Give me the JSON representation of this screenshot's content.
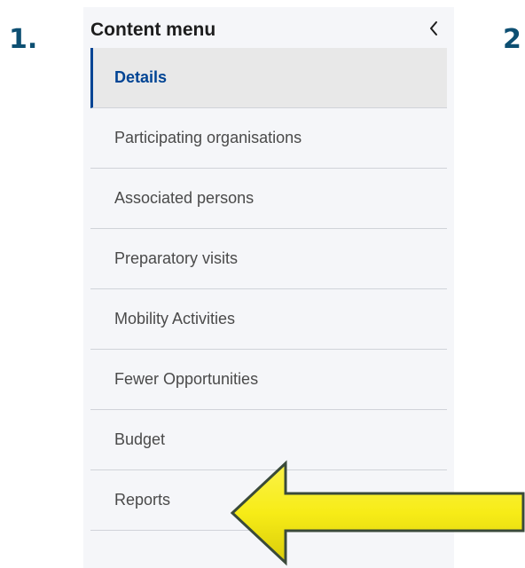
{
  "steps": {
    "first": "1.",
    "second": "2"
  },
  "panel": {
    "title": "Content menu",
    "collapse_icon": "chevron-left-icon",
    "items": [
      {
        "label": "Details",
        "active": true
      },
      {
        "label": "Participating organisations",
        "active": false
      },
      {
        "label": "Associated persons",
        "active": false
      },
      {
        "label": "Preparatory visits",
        "active": false
      },
      {
        "label": "Mobility Activities",
        "active": false
      },
      {
        "label": "Fewer Opportunities",
        "active": false
      },
      {
        "label": "Budget",
        "active": false
      },
      {
        "label": "Reports",
        "active": false
      }
    ]
  },
  "annotation": {
    "icon": "arrow-left-icon",
    "fill": "#f7ec17",
    "stroke": "#3a4a3a"
  },
  "colors": {
    "step_label": "#0d4f72",
    "active_accent": "#004494",
    "panel_bg": "#f5f6f9"
  }
}
